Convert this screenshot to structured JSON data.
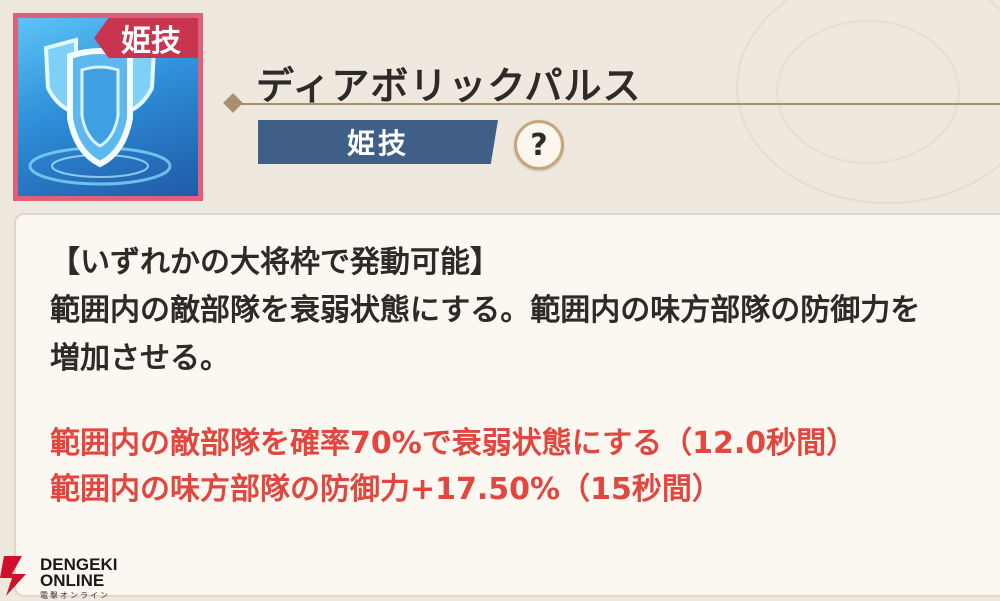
{
  "skill": {
    "icon_tag": "姫技",
    "name": "ディアボリックパルス",
    "type_badge": "姫技",
    "help_label": "?"
  },
  "description": {
    "condition": "【いずれかの大将枠で発動可能】",
    "line1": "範囲内の敵部隊を衰弱状態にする。範囲内の味方部隊の防御力を",
    "line2": "増加させる。"
  },
  "effects": [
    "範囲内の敵部隊を確率70%で衰弱状態にする（12.0秒間）",
    "範囲内の味方部隊の防御力+17.50%（15秒間）"
  ],
  "watermark": {
    "line1": "DENGEKI",
    "line2": "ONLINE",
    "sub": "電撃オンライン"
  },
  "colors": {
    "effect_text": "#e2473f",
    "badge": "#3f5f86",
    "icon_frame": "#e0607a"
  }
}
